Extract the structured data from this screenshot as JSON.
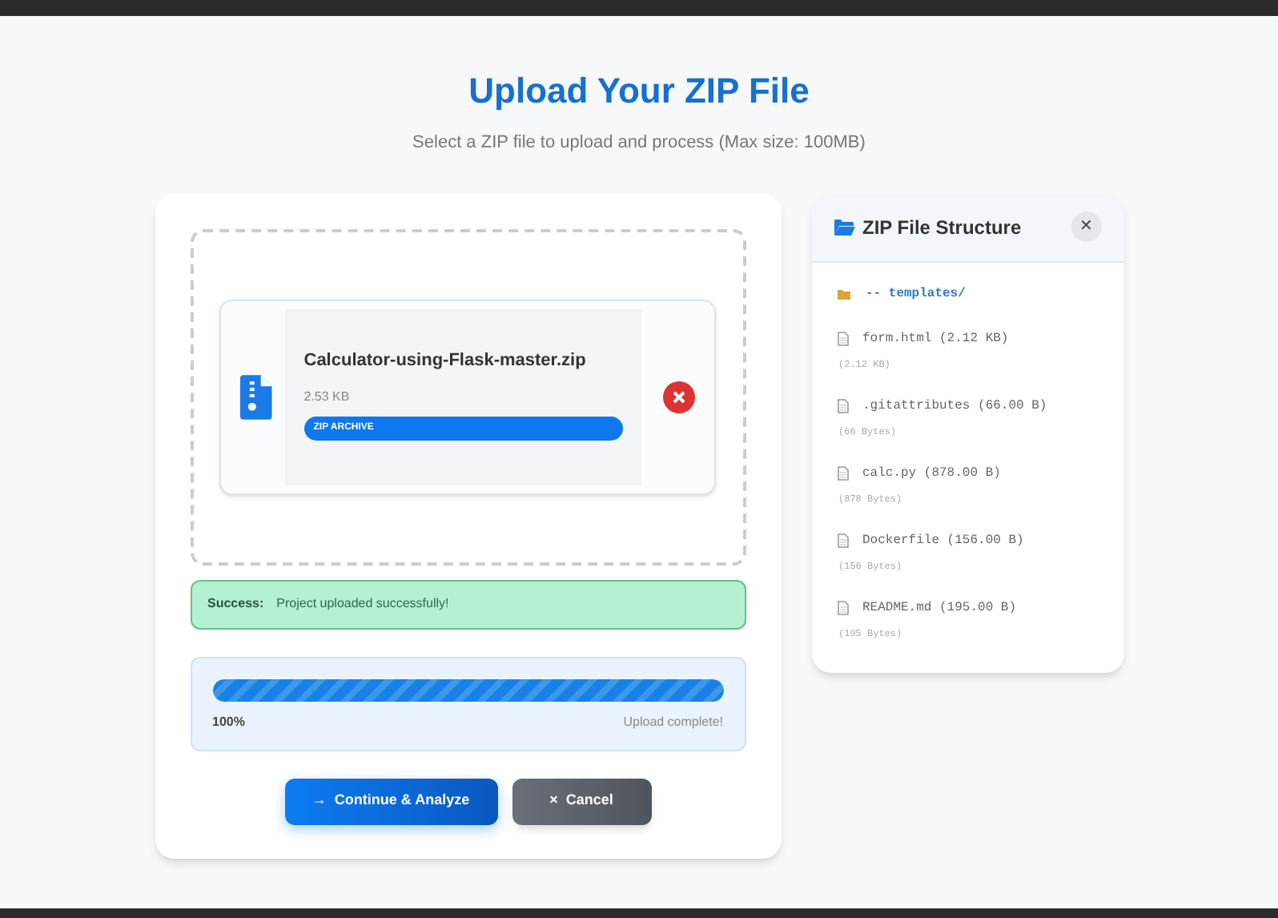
{
  "heading": {
    "title": "Upload Your ZIP File",
    "subtitle": "Select a ZIP file to upload and process (Max size: 100MB)"
  },
  "file": {
    "name": "Calculator-using-Flask-master.zip",
    "size": "2.53 KB",
    "badge": "ZIP ARCHIVE"
  },
  "alert": {
    "label": "Success:",
    "message": "Project uploaded successfully!"
  },
  "progress": {
    "level": 1,
    "percent": "100%",
    "status": "Upload complete!"
  },
  "buttons": [
    {
      "label": "Continue & Analyze",
      "kind": "primary",
      "icon": "→"
    },
    {
      "label": "Cancel",
      "kind": "secondary",
      "icon": "×"
    }
  ],
  "structure": {
    "title": "ZIP File Structure",
    "close": "✕",
    "items": [
      {
        "kind": "folder",
        "label": "-- templates/"
      },
      {
        "kind": "file",
        "label": "form.html (2.12 KB)",
        "detail": "(2.12 KB)"
      },
      {
        "kind": "file",
        "label": ".gitattributes (66.00 B)",
        "detail": "(66 Bytes)"
      },
      {
        "kind": "file",
        "label": "calc.py (878.00 B)",
        "detail": "(878 Bytes)"
      },
      {
        "kind": "file",
        "label": "Dockerfile (156.00 B)",
        "detail": "(156 Bytes)"
      },
      {
        "kind": "file",
        "label": "README.md (195.00 B)",
        "detail": "(195 Bytes)"
      }
    ]
  }
}
